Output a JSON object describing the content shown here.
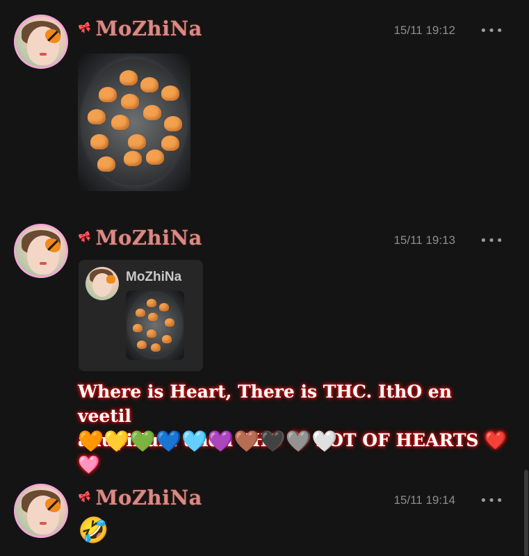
{
  "messages": [
    {
      "username": "MoZhiNa",
      "time": "15/11 19:12",
      "more": "•••",
      "type": "image",
      "image_desc": "hearts-frying-pan"
    },
    {
      "username": "MoZhiNa",
      "time": "15/11 19:13",
      "more": "•••",
      "type": "reply",
      "reply": {
        "username": "MoZhiNa"
      },
      "text_line1": "Where is Heart, There is THC. IthO en veetil",
      "text_line2": "adupillum undu THC 🧡 LOT OF HEARTS ❤️🩷",
      "text_line3": "🧡💛💚💙🩵💜🤎🖤🩶🤍"
    },
    {
      "username": "MoZhiNa",
      "time": "15/11 19:14",
      "more": "•••",
      "type": "emoji",
      "emoji": "🤣"
    }
  ],
  "icons": {
    "ribbon": "ribbon-icon",
    "more": "more-options-icon"
  },
  "colors": {
    "background": "#141414",
    "username": "#d98a84",
    "avatar_border": "#f4a6d8",
    "glow": "#d11a1a"
  }
}
